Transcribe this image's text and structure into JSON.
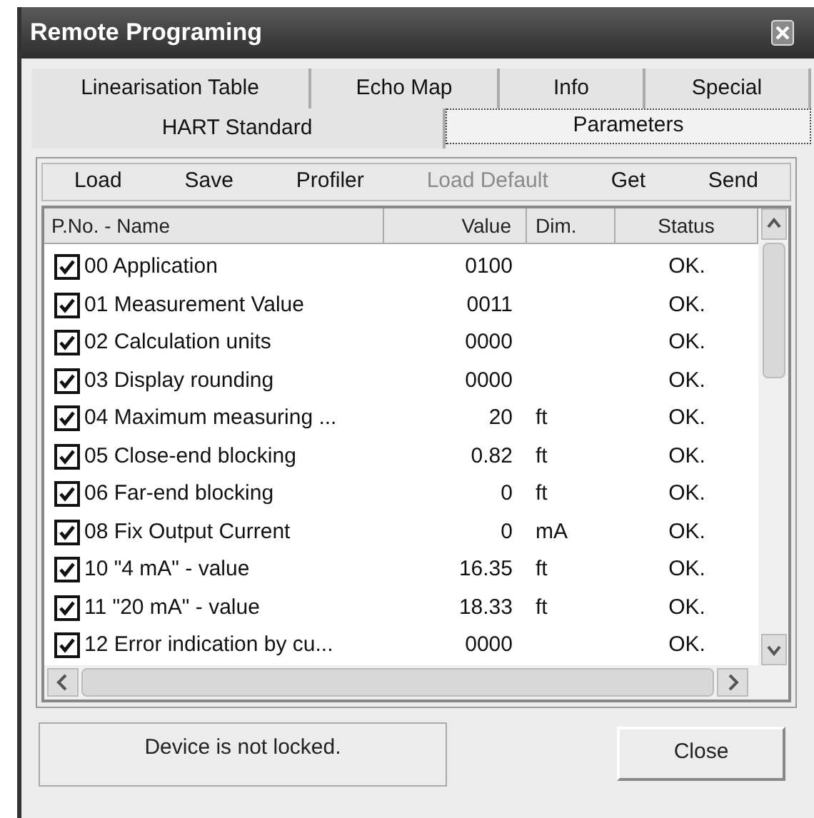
{
  "window": {
    "title": "Remote Programing"
  },
  "tab_rows": [
    [
      {
        "label": "Linearisation Table",
        "selected": false
      },
      {
        "label": "Echo Map",
        "selected": false
      },
      {
        "label": "Info",
        "selected": false
      },
      {
        "label": "Special",
        "selected": false
      }
    ],
    [
      {
        "label": "HART Standard",
        "selected": false
      },
      {
        "label": "Parameters",
        "selected": true
      }
    ]
  ],
  "toolbar": [
    {
      "label": "Load",
      "disabled": false
    },
    {
      "label": "Save",
      "disabled": false
    },
    {
      "label": "Profiler",
      "disabled": false
    },
    {
      "label": "Load Default",
      "disabled": true
    },
    {
      "label": "Get",
      "disabled": false
    },
    {
      "label": "Send",
      "disabled": false
    }
  ],
  "table": {
    "columns": [
      "P.No. - Name",
      "Value",
      "Dim.",
      "Status"
    ],
    "rows": [
      {
        "checked": true,
        "name": "00 Application",
        "value": "0100",
        "dim": "",
        "status": "OK."
      },
      {
        "checked": true,
        "name": "01 Measurement Value",
        "value": "0011",
        "dim": "",
        "status": "OK."
      },
      {
        "checked": true,
        "name": "02 Calculation units",
        "value": "0000",
        "dim": "",
        "status": "OK."
      },
      {
        "checked": true,
        "name": "03 Display rounding",
        "value": "0000",
        "dim": "",
        "status": "OK."
      },
      {
        "checked": true,
        "name": "04 Maximum measuring ...",
        "value": "20",
        "dim": "ft",
        "status": "OK."
      },
      {
        "checked": true,
        "name": "05 Close-end blocking",
        "value": "0.82",
        "dim": "ft",
        "status": "OK."
      },
      {
        "checked": true,
        "name": "06 Far-end blocking",
        "value": "0",
        "dim": "ft",
        "status": "OK."
      },
      {
        "checked": true,
        "name": "08 Fix Output Current",
        "value": "0",
        "dim": "mA",
        "status": "OK."
      },
      {
        "checked": true,
        "name": "10 \"4 mA\" - value",
        "value": "16.35",
        "dim": "ft",
        "status": "OK."
      },
      {
        "checked": true,
        "name": "11 \"20 mA\" - value",
        "value": "18.33",
        "dim": "ft",
        "status": "OK."
      },
      {
        "checked": true,
        "name": "12 Error indication by cu...",
        "value": "0000",
        "dim": "",
        "status": "OK."
      }
    ]
  },
  "status_bar": {
    "message": "Device is not locked.",
    "close_button": "Close"
  }
}
